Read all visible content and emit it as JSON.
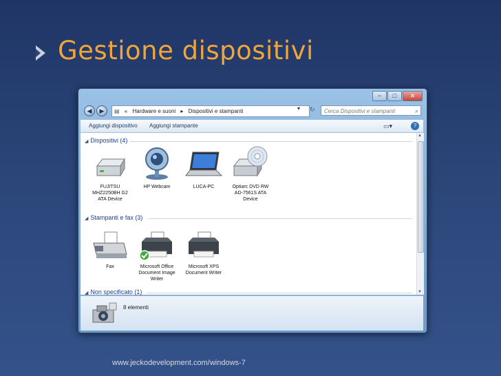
{
  "slide": {
    "title": "Gestione dispositivi",
    "footer_url": "www.jeckodevelopment.com/windows-7"
  },
  "window": {
    "controls": {
      "minimize": "−",
      "maximize": "□",
      "close": "✕"
    },
    "nav": {
      "back": "◀",
      "forward": "▶"
    },
    "address": {
      "root": "«",
      "parts": [
        "Hardware e suoni",
        "▸",
        "Dispositivi e stampanti"
      ],
      "dropdown": "▾",
      "refresh": "↻"
    },
    "search": {
      "placeholder": "Cerca Dispositivi e stampanti",
      "icon": "search-icon"
    },
    "toolbar": {
      "add_device": "Aggiungi dispositivo",
      "add_printer": "Aggiungi stampante"
    },
    "groups": {
      "devices": {
        "label": "Dispositivi (4)",
        "items": [
          {
            "label": "FUJITSU MHZ2250BH G2 ATA Device",
            "icon": "hard-drive-icon"
          },
          {
            "label": "HP Webcam",
            "icon": "webcam-icon"
          },
          {
            "label": "LUCA-PC",
            "icon": "laptop-icon"
          },
          {
            "label": "Optiarc DVD RW AD-7561S ATA Device",
            "icon": "dvd-drive-icon"
          }
        ]
      },
      "printers": {
        "label": "Stampanti e fax (3)",
        "items": [
          {
            "label": "Fax",
            "icon": "fax-icon"
          },
          {
            "label": "Microsoft Office Document Image Writer",
            "icon": "printer-icon",
            "default": true
          },
          {
            "label": "Microsoft XPS Document Writer",
            "icon": "printer-icon"
          }
        ]
      },
      "unspecified": {
        "label": "Non specificato (1)"
      }
    },
    "details": {
      "count": "8 elementi"
    }
  }
}
